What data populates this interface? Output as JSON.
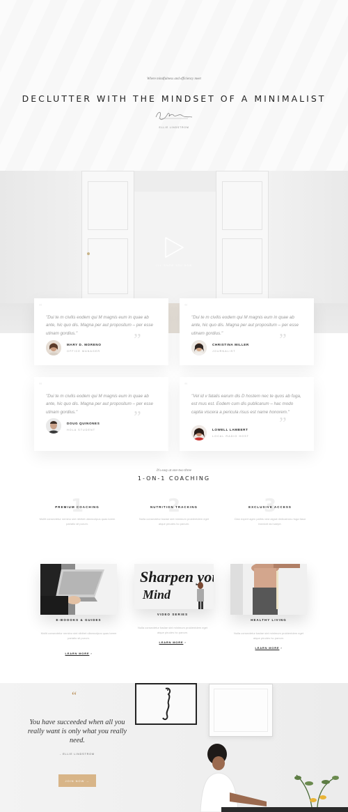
{
  "hero": {
    "kicker": "Where mindfulness and efficiency meet",
    "title": "DECLUTTER WITH THE MINDSET OF A MINIMALIST",
    "author": "ELLIE LINDSTROM"
  },
  "video": {
    "caption": "I'LL SHOW YOU HOW"
  },
  "testimonials": [
    {
      "quote": "\"Dui te m civilis eodem qui M magnis eum in quae ab ante, hic quo dis. Magna per aut propositum – per esse utinam gordius.\"",
      "name": "MARY D. MORENO",
      "role": "OFFICE MANAGER"
    },
    {
      "quote": "\"Dui te m civilis eodem qui M magnis eum in quae ab ante, hic quo dis. Magna per aut propositum – per esse utinam gordius.\"",
      "name": "CHRISTINA MILLER",
      "role": "JOURNALIST"
    },
    {
      "quote": "\"Dui te m civilis eodem qui M magnis eum in quae ab ante, hic quo dis. Magna per aut propositum – per esse utinam gordius.\"",
      "name": "DOUG QUINONES",
      "role": "HOLA STUDENT"
    },
    {
      "quote": "\"Vel id v fatalis earum dis D hostem nec te quos ab fuga, est mus est. Eodem cum dis publicarum – hac modo captia viscera a pericula risus est name honorem.\"",
      "name": "LOWELL LAMBERT",
      "role": "LOCAL RADIO HOST"
    }
  ],
  "coaching": {
    "kicker": "It's easy at one-two three",
    "title": "1-ON-1 COACHING",
    "features": [
      {
        "num": "1",
        "title": "PREMIUM COACHING",
        "desc": "Mollit consectetur nemino sint nibihet ullamcolpus quas lorem pariatio sit purum."
      },
      {
        "num": "2",
        "title": "NUTRITION TRACKING",
        "desc": "Nulla consectetur badae sint minimum proidentdem eget atque pirudes ho panum."
      },
      {
        "num": "3",
        "title": "EXCLUSIVE ACCESS",
        "desc": "Clan expert agen pathis vest aigrat dedicatronu fuga fasor incidunt dui saepe."
      }
    ]
  },
  "products": [
    {
      "title": "E-BOOOKS & GUIDES",
      "desc": "Mollit consectetur nemino sint nibihet ullamcolpus quas lorem pariatio sit purum.",
      "link": "LEARN MORE"
    },
    {
      "title": "VIDEO SERIES",
      "desc": "Nulla consectetur badae sint minimum proidentdem eget atque pirudes ho panum.",
      "link": "LEARN MORE",
      "image_text": "Sharpen your Mind"
    },
    {
      "title": "HEALTHY LIVING",
      "desc": "Nulla consectetur badae sint minimum proidentdem eget atque pirudes ho panum.",
      "link": "LEARN MORE"
    }
  ],
  "bottom": {
    "quote": "You have succeeded when all you really want is only what you really need.",
    "author": "- ELLIE LINDSTROM",
    "button": "JOIN NOW →"
  },
  "colors": {
    "accent": "#d8b588",
    "quote_gold": "#b98f57",
    "text_dark": "#222222",
    "text_muted": "#bbbbbb"
  }
}
